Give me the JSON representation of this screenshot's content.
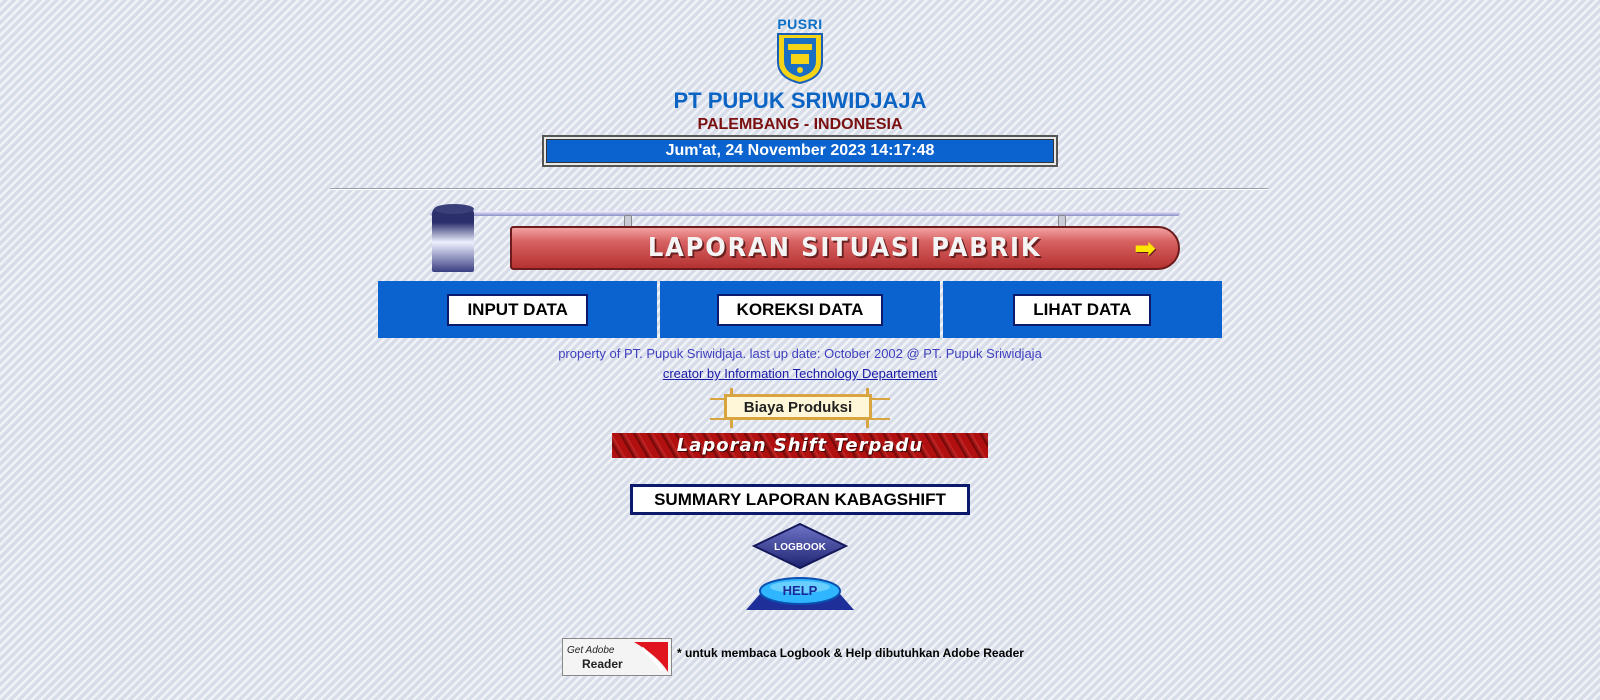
{
  "header": {
    "logo_text": "PUSRI",
    "company": "PT PUPUK SRIWIDJAJA",
    "city": "PALEMBANG - INDONESIA",
    "datetime": "Jum'at, 24 November 2023 14:17:48"
  },
  "banner": {
    "title": "LAPORAN SITUASI PABRIK"
  },
  "nav": {
    "input": "INPUT DATA",
    "koreksi": "KOREKSI DATA",
    "lihat": "LIHAT DATA"
  },
  "footer_info": {
    "property": "property of PT. Pupuk Sriwidjaja. last up date: October 2002 @ PT. Pupuk Sriwidjaja",
    "creator": "creator by Information Technology Departement"
  },
  "links": {
    "biaya": "Biaya Produksi",
    "shift": "Laporan Shift Terpadu",
    "summary": "SUMMARY LAPORAN KABAGSHIFT",
    "logbook": "LOGBOOK",
    "help": "HELP"
  },
  "adobe": {
    "get": "Get Adobe",
    "reader": "Reader",
    "note": "* untuk membaca Logbook & Help dibutuhkan Adobe Reader"
  },
  "colors": {
    "primary_blue": "#0a63cf",
    "title_blue": "#0b63c4",
    "maroon": "#7a1010"
  }
}
